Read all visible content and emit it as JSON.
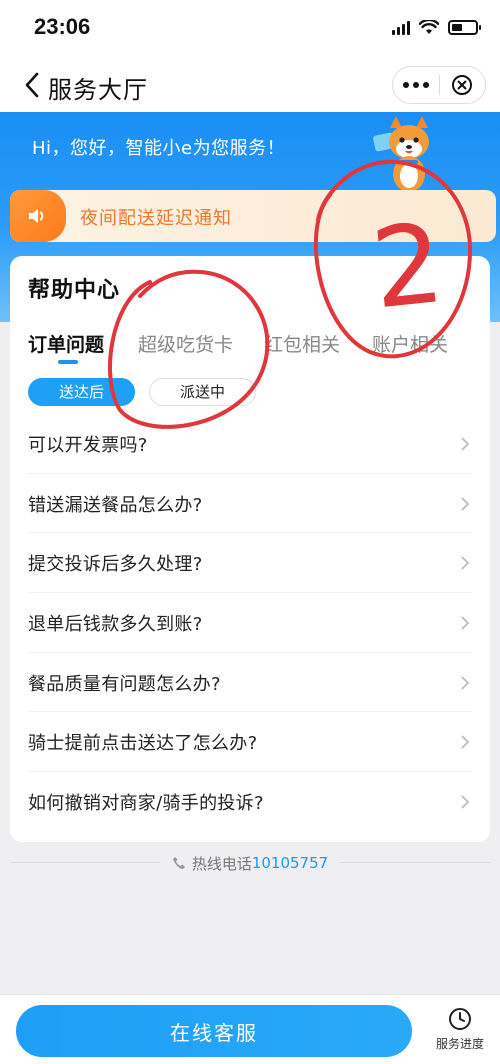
{
  "status_bar": {
    "time": "23:06",
    "battery_level": 0.45
  },
  "nav": {
    "title": "服务大厅",
    "more_icon": "more-dots-icon",
    "close_icon": "close-circle-icon"
  },
  "banner": {
    "greeting": "Hi，您好，智能小e为您服务！"
  },
  "notice": {
    "icon": "speaker-icon",
    "text": "夜间配送延迟通知"
  },
  "help_center": {
    "title": "帮助中心",
    "tabs": [
      {
        "label": "订单问题",
        "active": true
      },
      {
        "label": "超级吃货卡",
        "active": false
      },
      {
        "label": "红包相关",
        "active": false
      },
      {
        "label": "账户相关",
        "active": false
      }
    ],
    "chips": [
      {
        "label": "送达后",
        "active": true
      },
      {
        "label": "派送中",
        "active": false
      }
    ],
    "faqs": [
      "可以开发票吗?",
      "错送漏送餐品怎么办?",
      "提交投诉后多久处理?",
      "退单后钱款多久到账?",
      "餐品质量有问题怎么办?",
      "骑士提前点击送达了怎么办?",
      "如何撤销对商家/骑手的投诉?"
    ]
  },
  "hotline": {
    "label": "热线电话",
    "number": "10105757"
  },
  "bottom": {
    "cs_button": "在线客服",
    "progress_label": "服务进度"
  },
  "annotation": {
    "number": "2",
    "color": "#e0373c"
  },
  "colors": {
    "accent": "#1796f4",
    "notice_text": "#f0772a",
    "hotline_number": "#1a9af5"
  }
}
